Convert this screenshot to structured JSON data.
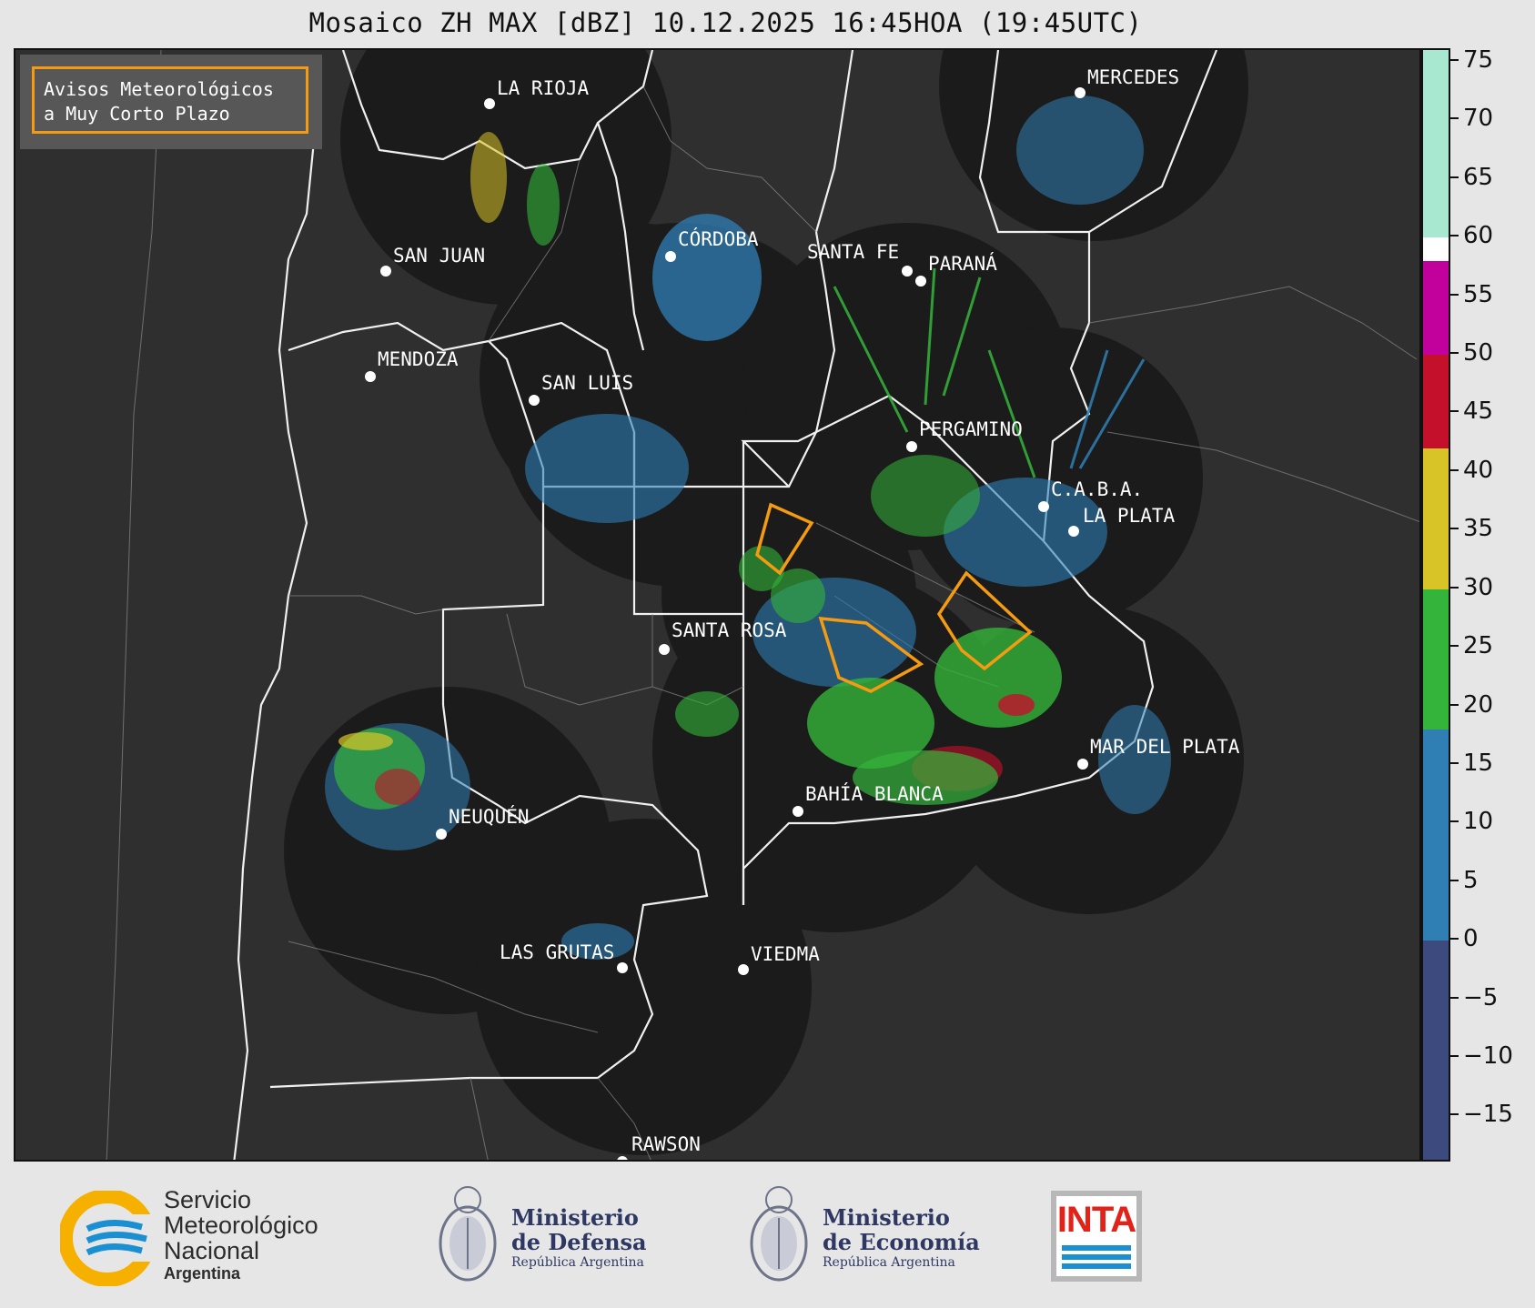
{
  "header": {
    "title": "Mosaico ZH MAX [dBZ] 10.12.2025 16:45HOA (19:45UTC)"
  },
  "legend_box": {
    "line1": "Avisos Meteorológicos",
    "line2": "a Muy Corto Plazo"
  },
  "cities": [
    {
      "name": "LA RIOJA"
    },
    {
      "name": "MERCEDES"
    },
    {
      "name": "CÓRDOBA"
    },
    {
      "name": "SAN JUAN"
    },
    {
      "name": "SANTA FE"
    },
    {
      "name": "PARANÁ"
    },
    {
      "name": "MENDOZA"
    },
    {
      "name": "SAN LUIS"
    },
    {
      "name": "PERGAMINO"
    },
    {
      "name": "C.A.B.A."
    },
    {
      "name": "LA PLATA"
    },
    {
      "name": "SANTA ROSA"
    },
    {
      "name": "MAR DEL PLATA"
    },
    {
      "name": "BAHÍA BLANCA"
    },
    {
      "name": "NEUQUÉN"
    },
    {
      "name": "LAS GRUTAS"
    },
    {
      "name": "VIEDMA"
    },
    {
      "name": "RAWSON"
    }
  ],
  "colorbar": {
    "unit": "dBZ",
    "min": -19,
    "max": 76,
    "ticks": [
      "75",
      "70",
      "65",
      "60",
      "55",
      "50",
      "45",
      "40",
      "35",
      "30",
      "25",
      "20",
      "15",
      "10",
      "5",
      "0",
      "−5",
      "−10",
      "−15"
    ],
    "tick_values": [
      75,
      70,
      65,
      60,
      55,
      50,
      45,
      40,
      35,
      30,
      25,
      20,
      15,
      10,
      5,
      0,
      -5,
      -10,
      -15
    ],
    "bands": [
      {
        "from": -19,
        "to": 0,
        "color": "#3d4a7e"
      },
      {
        "from": 0,
        "to": 18,
        "color": "#2f7fb5"
      },
      {
        "from": 18,
        "to": 30,
        "color": "#34b43a"
      },
      {
        "from": 30,
        "to": 42,
        "color": "#d9c427"
      },
      {
        "from": 42,
        "to": 50,
        "color": "#c4102a"
      },
      {
        "from": 50,
        "to": 58,
        "color": "#c2009c"
      },
      {
        "from": 58,
        "to": 60,
        "color": "#ffffff"
      },
      {
        "from": 60,
        "to": 76,
        "color": "#a8e8d0"
      }
    ]
  },
  "colors": {
    "radar_disc": "#1b1b1b",
    "warning": "#f49b12",
    "background": "#2f2f2f"
  },
  "logos": {
    "smn": {
      "line1": "Servicio",
      "line2": "Meteorológico",
      "line3": "Nacional",
      "line4": "Argentina"
    },
    "defensa": {
      "line1": "Ministerio",
      "line2": "de Defensa",
      "line3": "República Argentina"
    },
    "economia": {
      "line1": "Ministerio",
      "line2": "de Economía",
      "line3": "República Argentina"
    },
    "inta": {
      "text": "INTA"
    }
  }
}
